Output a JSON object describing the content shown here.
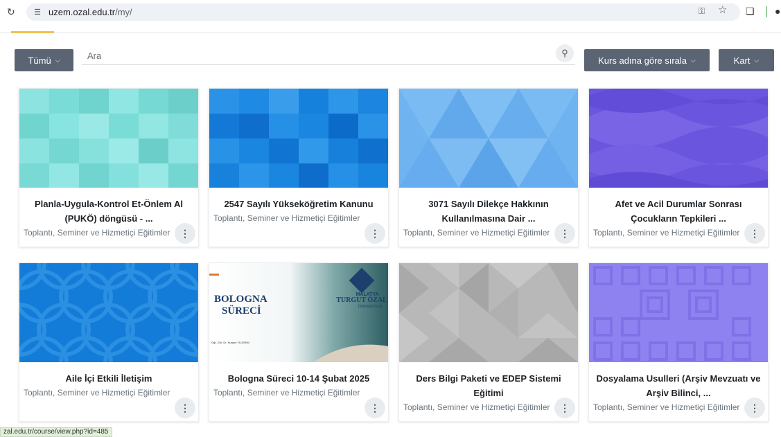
{
  "browser": {
    "url_host": "uzem.ozal.edu.tr",
    "url_path": "/my/"
  },
  "filters": {
    "group_label": "Tümü",
    "search_placeholder": "Ara",
    "sort_label": "Kurs adına göre sırala",
    "view_label": "Kart"
  },
  "courses": [
    {
      "title": "Planla-Uygula-Kontrol Et-Önlem Al (PUKÖ) döngüsü - ...",
      "category": "Toplantı, Seminer ve Hizmetiçi Eğitimler"
    },
    {
      "title": "2547 Sayılı Yükseköğretim Kanunu",
      "category": "Toplantı, Seminer ve Hizmetiçi Eğitimler"
    },
    {
      "title": "3071 Sayılı Dilekçe Hakkının Kullanılmasına Dair ...",
      "category": "Toplantı, Seminer ve Hizmetiçi Eğitimler"
    },
    {
      "title": "Afet ve Acil Durumlar Sonrası Çocukların Tepkileri ...",
      "category": "Toplantı, Seminer ve Hizmetiçi Eğitimler"
    },
    {
      "title": "Aile İçi Etkili İletişim",
      "category": "Toplantı, Seminer ve Hizmetiçi Eğitimler"
    },
    {
      "title": "Bologna Süreci 10-14 Şubat 2025",
      "category": "Toplantı, Seminer ve Hizmetiçi Eğitimler"
    },
    {
      "title": "Ders Bilgi Paketi ve EDEP Sistemi Eğitimi",
      "category": "Toplantı, Seminer ve Hizmetiçi Eğitimler"
    },
    {
      "title": "Dosyalama Usulleri (Arşiv Mevzuatı ve Arşiv Bilinci, ...",
      "category": "Toplantı, Seminer ve Hizmetiçi Eğitimler"
    }
  ],
  "bologna_image": {
    "heading_line1": "BOLOGNA",
    "heading_line2": "SÜRECİ",
    "uni_line1": "MALATYA",
    "uni_line2": "TURGUT ÖZAL",
    "uni_line3": "ÜNİVERSİTESİ",
    "presenter": "Öğr. Gör. Dr. Nurşen YILDIRIM"
  },
  "status_bar": {
    "link": "zal.edu.tr/course/view.php?id=485"
  },
  "icons": {
    "reload": "reload-icon",
    "site_info": "tune-icon",
    "key": "key-icon",
    "star": "star-icon",
    "extensions": "puzzle-icon",
    "search": "search-icon",
    "card_menu": "vertical-dots-icon"
  },
  "colors": {
    "button_bg": "#5a6473",
    "tab_active": "#f0c14b"
  }
}
